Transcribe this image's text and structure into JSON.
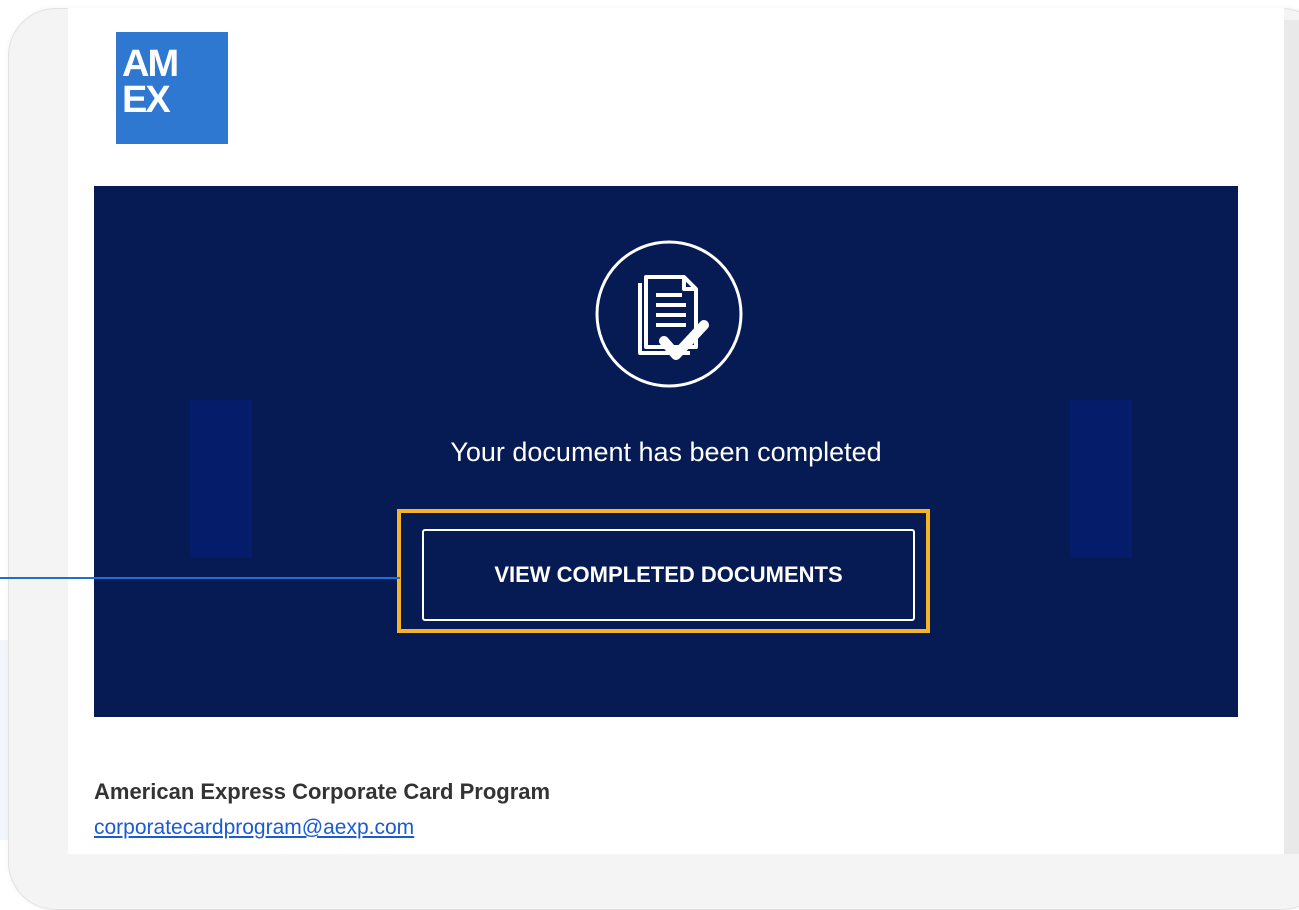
{
  "logo": {
    "text": "AM\nEX",
    "color": "#2e78d2"
  },
  "hero": {
    "title": "Your document has been completed",
    "cta_label": "VIEW COMPLETED DOCUMENTS",
    "background": "#061a54",
    "icon": "document-check-icon"
  },
  "footer": {
    "program_name": "American Express Corporate Card Program",
    "email": "corporatecardprogram@aexp.com"
  },
  "highlight_color": "#f5b428",
  "callout_color": "#1f6fd0"
}
